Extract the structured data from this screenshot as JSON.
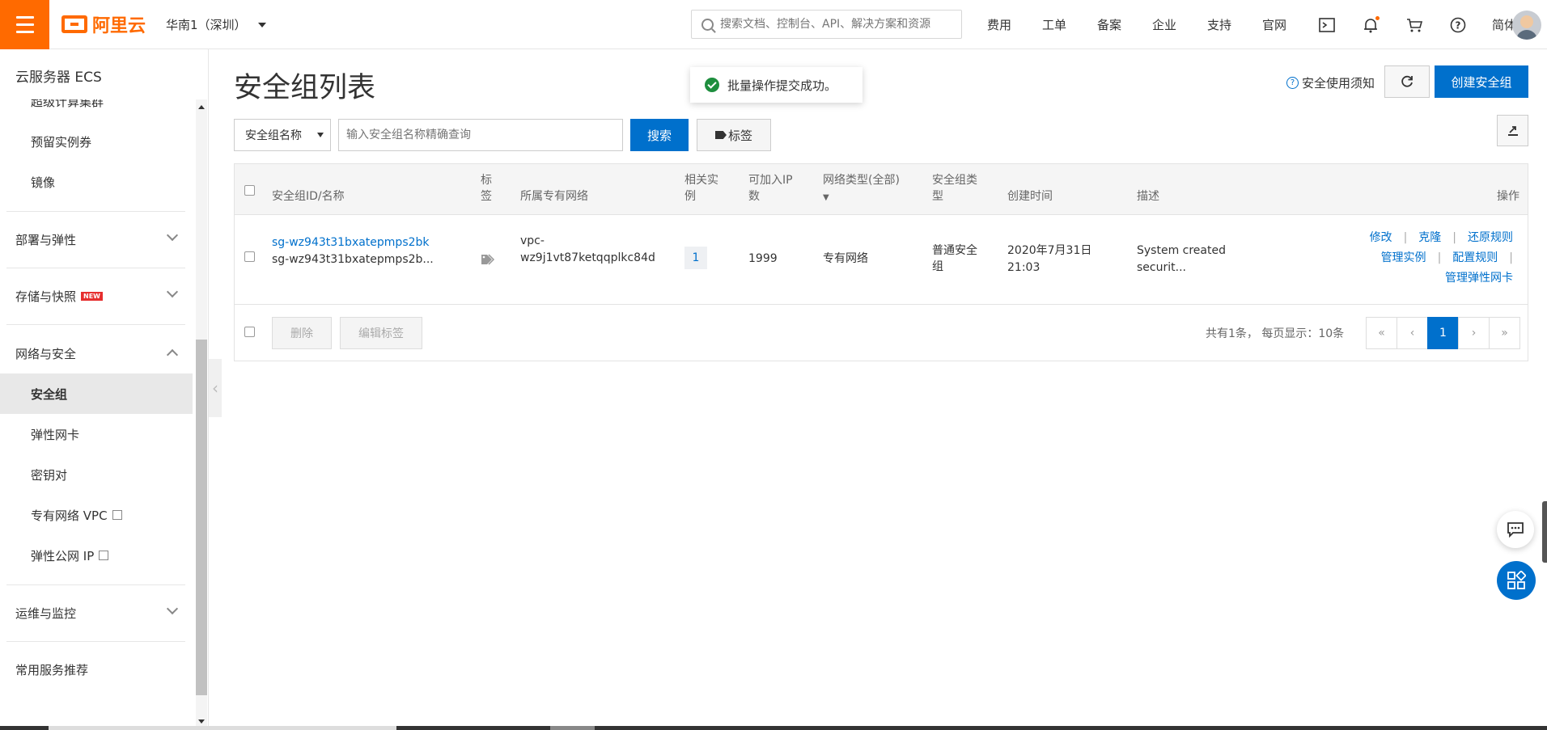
{
  "topbar": {
    "logo_text": "阿里云",
    "region": "华南1（深圳）",
    "search_placeholder": "搜索文档、控制台、API、解决方案和资源",
    "nav": [
      "费用",
      "工单",
      "备案",
      "企业",
      "支持",
      "官网"
    ],
    "lang": "简体"
  },
  "sidebar": {
    "title": "云服务器 ECS",
    "items": [
      {
        "label": "超级计算集群"
      },
      {
        "label": "预留实例券"
      },
      {
        "label": "镜像"
      },
      {
        "label": "部署与弹性"
      },
      {
        "label": "存储与快照",
        "badge": "NEW"
      },
      {
        "label": "网络与安全"
      },
      {
        "label": "安全组"
      },
      {
        "label": "弹性网卡"
      },
      {
        "label": "密钥对"
      },
      {
        "label": "专有网络 VPC"
      },
      {
        "label": "弹性公网 IP"
      },
      {
        "label": "运维与监控"
      },
      {
        "label": "常用服务推荐"
      }
    ]
  },
  "main": {
    "title": "安全组列表",
    "toast": "批量操作提交成功。",
    "help_link": "安全使用须知",
    "create_button": "创建安全组",
    "filter": {
      "select_value": "安全组名称",
      "input_placeholder": "输入安全组名称精确查询",
      "search_button": "搜索",
      "tag_button": "标签"
    },
    "table": {
      "headers": {
        "id_name": "安全组ID/名称",
        "tag": "标签",
        "vpc": "所属专有网络",
        "instances": "相关实例",
        "ip_count": "可加入IP数",
        "net_type": "网络类型(全部)",
        "sg_type": "安全组类型",
        "created": "创建时间",
        "desc": "描述",
        "ops": "操作"
      },
      "rows": [
        {
          "id": "sg-wz943t31bxatepmps2bk",
          "name": "sg-wz943t31bxatepmps2b...",
          "vpc_line1": "vpc-",
          "vpc_line2": "wz9j1vt87ketqqplkc84d",
          "instances": "1",
          "ip_count": "1999",
          "net_type": "专有网络",
          "sg_type": "普通安全组",
          "created_line1": "2020年7月31日",
          "created_line2": "21:03",
          "desc_line1": "System created",
          "desc_line2": "securit...",
          "ops": [
            "修改",
            "克隆",
            "还原规则",
            "管理实例",
            "配置规则",
            "管理弹性网卡"
          ]
        }
      ]
    },
    "footer": {
      "delete_button": "删除",
      "edit_tag_button": "编辑标签",
      "pager_info": "共有1条， 每页显示：10条",
      "pages": [
        "«",
        "‹",
        "1",
        "›",
        "»"
      ]
    }
  }
}
